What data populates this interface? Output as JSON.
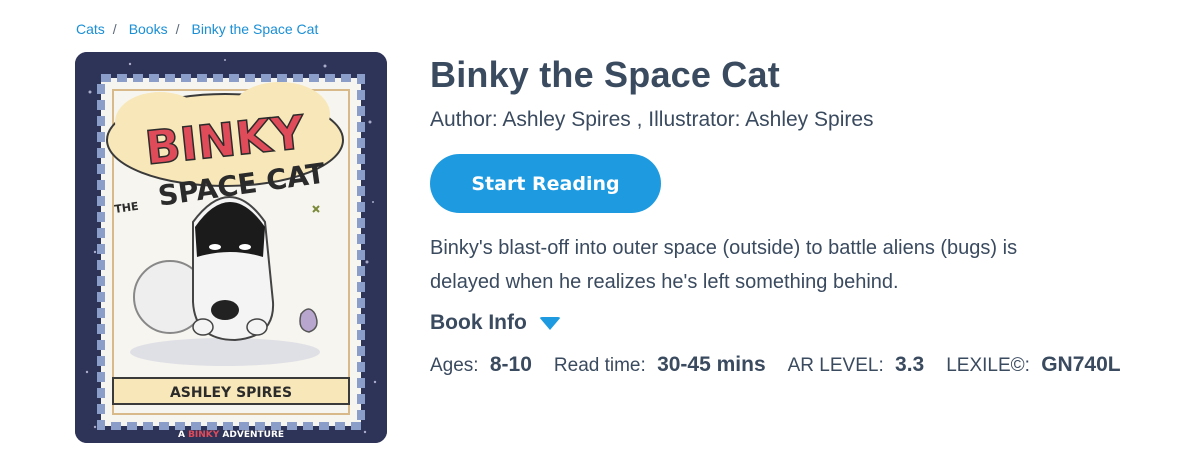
{
  "breadcrumb": {
    "items": [
      "Cats",
      "Books",
      "Binky the Space Cat"
    ],
    "separator": "/"
  },
  "cover": {
    "alt": "Binky the Space Cat book cover",
    "colors": {
      "frame": "#2e3358",
      "panel": "#f7f5ef",
      "title_red": "#e04b5a",
      "cloud": "#f8e7b8"
    }
  },
  "book": {
    "title": "Binky the Space Cat",
    "byline": "Author: Ashley Spires , Illustrator: Ashley Spires",
    "start_label": "Start Reading",
    "description": "Binky's blast-off into outer space (outside) to battle aliens (bugs) is delayed when he realizes he's left something behind.",
    "info_label": "Book Info"
  },
  "meta": {
    "ages_label": "Ages:",
    "ages": "8-10",
    "read_label": "Read time:",
    "read": "30-45 mins",
    "ar_label": "AR LEVEL:",
    "ar": "3.3",
    "lexile_label": "LEXILE©:",
    "lexile": "GN740L"
  },
  "colors": {
    "accent": "#1e9be0",
    "text": "#3a4a5f",
    "link": "#1a8fd6"
  }
}
